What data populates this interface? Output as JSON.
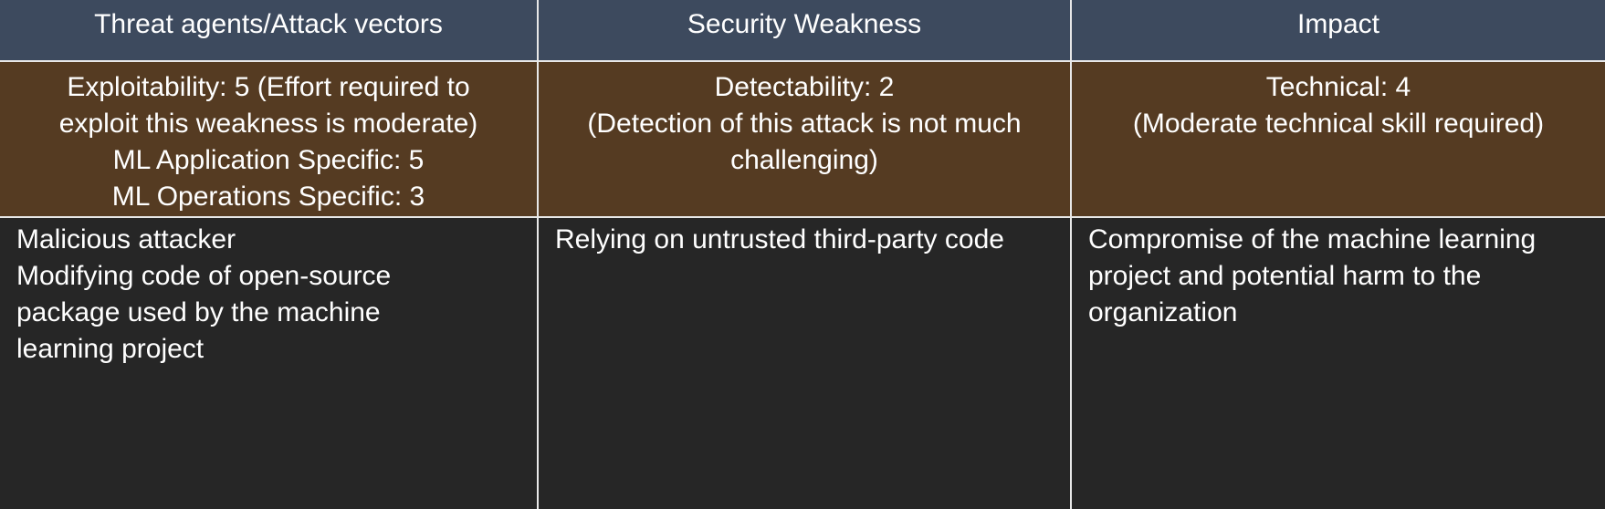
{
  "headers": [
    "Threat agents/Attack vectors",
    "Security Weakness",
    "Impact"
  ],
  "ratings": {
    "exploitability": [
      "Exploitability: 5 (Effort required to",
      "exploit this weakness is moderate)",
      "ML Application Specific: 5",
      "ML Operations Specific: 3"
    ],
    "detectability": [
      "Detectability: 2",
      "(Detection of this attack is not much",
      "challenging)"
    ],
    "technical": [
      "Technical: 4",
      "(Moderate technical skill required)"
    ]
  },
  "details": {
    "threat_agents": [
      "Malicious attacker",
      "Modifying code of open-source",
      "package used by the machine",
      "learning project"
    ],
    "security_weakness": [
      "Relying on untrusted third-party code"
    ],
    "impact": [
      "Compromise of the machine learning",
      "project and potential harm to the",
      "organization"
    ]
  },
  "colors": {
    "header_bg": "#3d4a5e",
    "rating_bg": "#553b22",
    "detail_bg": "#262626",
    "border": "#e8e8e8",
    "text": "#ffffff"
  }
}
